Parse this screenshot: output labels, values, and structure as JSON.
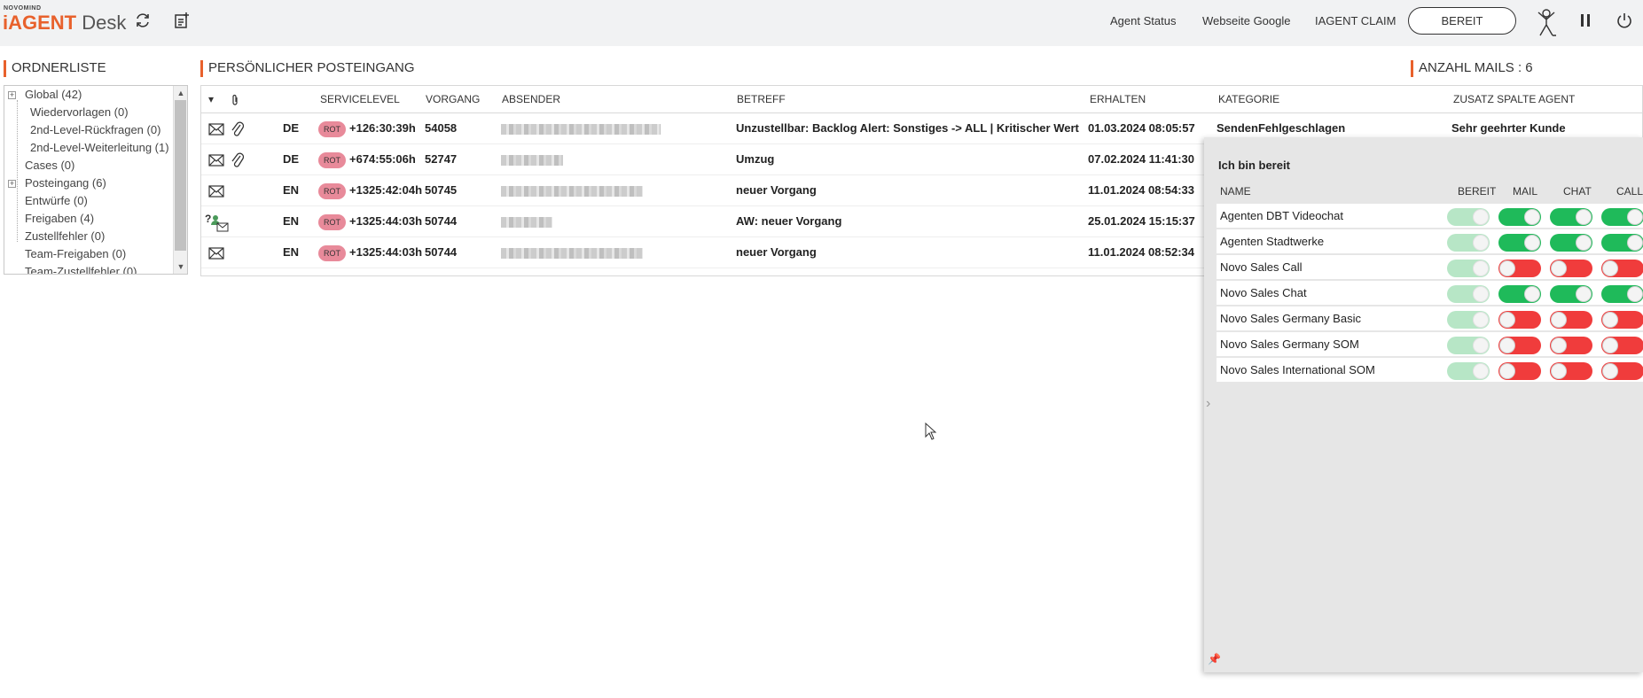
{
  "header": {
    "logo_small": "NOVOMIND",
    "logo_brand": "iAGENT",
    "logo_desk": "Desk",
    "links": [
      "Agent Status",
      "Webseite Google",
      "IAGENT CLAIM"
    ],
    "bereit_button": "BEREIT",
    "icons": [
      "refresh-icon",
      "new-document-icon",
      "agent-avatar-icon",
      "pause-icon",
      "power-icon"
    ]
  },
  "folders": {
    "title": "ORDNERLISTE",
    "items": [
      "Global (42)",
      "Wiedervorlagen (0)",
      "2nd-Level-Rückfragen (0)",
      "2nd-Level-Weiterleitung (1)",
      "Cases (0)",
      "Posteingang (6)",
      "Entwürfe (0)",
      "Freigaben (4)",
      "Zustellfehler (0)",
      "Team-Freigaben (0)",
      "Team-Zustellfehler (0)"
    ]
  },
  "inbox": {
    "title": "PERSÖNLICHER POSTEINGANG",
    "count_label": "ANZAHL MAILS : 6",
    "columns": [
      "SERVICELEVEL",
      "VORGANG",
      "ABSENDER",
      "BETREFF",
      "ERHALTEN",
      "KATEGORIE",
      "ZUSATZ SPALTE AGENT"
    ],
    "rows": [
      {
        "lang": "DE",
        "badge": "ROT",
        "sl": "+126:30:39h",
        "vorgang": "54058",
        "betreff": "Unzustellbar: Backlog Alert: Sonstiges -> ALL | Kritischer Wert",
        "erhalten": "01.03.2024 08:05:57",
        "kategorie": "SendenFehlgeschlagen",
        "zusatz": "Sehr geehrter Kunde"
      },
      {
        "lang": "DE",
        "badge": "ROT",
        "sl": "+674:55:06h",
        "vorgang": "52747",
        "betreff": "Umzug",
        "erhalten": "07.02.2024 11:41:30",
        "kategorie": "",
        "zusatz": ""
      },
      {
        "lang": "EN",
        "badge": "ROT",
        "sl": "+1325:42:04h",
        "vorgang": "50745",
        "betreff": "neuer Vorgang",
        "erhalten": "11.01.2024 08:54:33",
        "kategorie": "",
        "zusatz": ""
      },
      {
        "lang": "EN",
        "badge": "ROT",
        "sl": "+1325:44:03h",
        "vorgang": "50744",
        "betreff": "AW: neuer Vorgang",
        "erhalten": "25.01.2024 15:15:37",
        "kategorie": "",
        "zusatz": ""
      },
      {
        "lang": "EN",
        "badge": "ROT",
        "sl": "+1325:44:03h",
        "vorgang": "50744",
        "betreff": "neuer Vorgang",
        "erhalten": "11.01.2024 08:52:34",
        "kategorie": "",
        "zusatz": ""
      }
    ]
  },
  "ready_panel": {
    "title": "Ich bin bereit",
    "columns": [
      "NAME",
      "BEREIT",
      "MAIL",
      "CHAT",
      "CALL"
    ],
    "channels": [
      {
        "name": "Agenten DBT Videochat",
        "mail": "on",
        "chat": "on",
        "call": "on"
      },
      {
        "name": "Agenten Stadtwerke",
        "mail": "on",
        "chat": "on",
        "call": "on"
      },
      {
        "name": "Novo Sales Call",
        "mail": "off",
        "chat": "off",
        "call": "off"
      },
      {
        "name": "Novo Sales Chat",
        "mail": "on",
        "chat": "on",
        "call": "on"
      },
      {
        "name": "Novo Sales Germany Basic",
        "mail": "off",
        "chat": "off",
        "call": "off"
      },
      {
        "name": "Novo Sales Germany SOM",
        "mail": "off",
        "chat": "off",
        "call": "off"
      },
      {
        "name": "Novo Sales International SOM",
        "mail": "off",
        "chat": "off",
        "call": "off"
      }
    ]
  },
  "colors": {
    "accent": "#e8612c",
    "toggle_on": "#1fba5a",
    "toggle_off": "#f03c3c",
    "toggle_disabled": "#b7e6c6",
    "badge": "#e88a9a"
  }
}
